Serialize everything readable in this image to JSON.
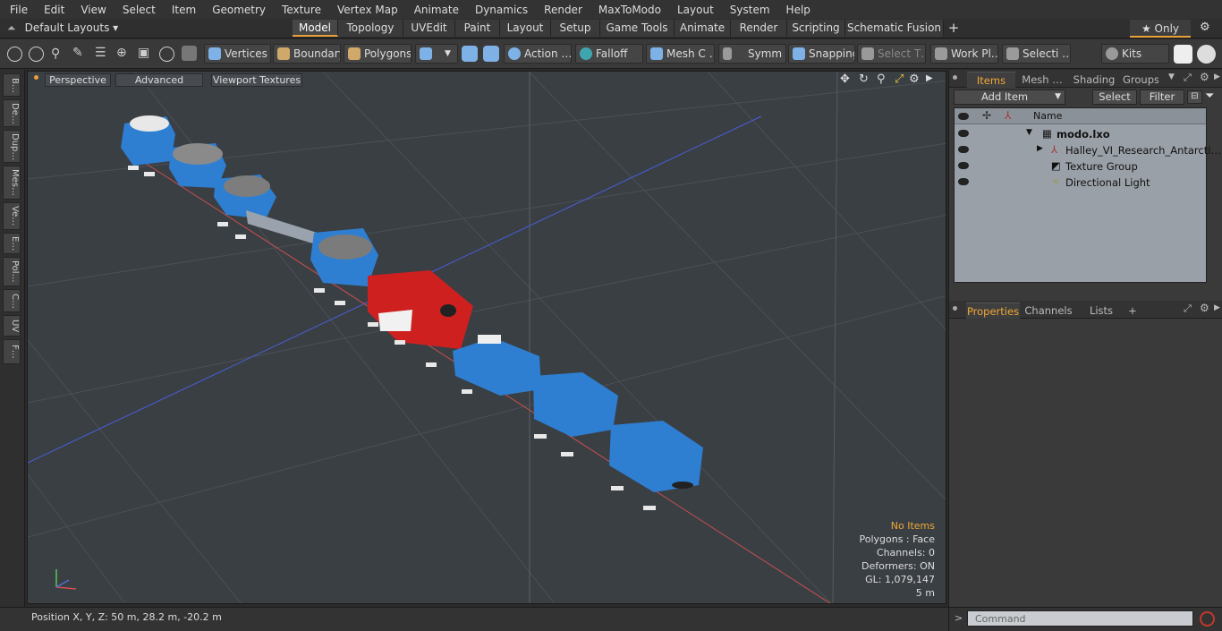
{
  "menu": [
    "File",
    "Edit",
    "View",
    "Select",
    "Item",
    "Geometry",
    "Texture",
    "Vertex Map",
    "Animate",
    "Dynamics",
    "Render",
    "MaxToModo",
    "Layout",
    "System",
    "Help"
  ],
  "layout": {
    "label": "Default Layouts ▾",
    "only_label": "★ Only"
  },
  "tabs": [
    "Model",
    "Topology",
    "UVEdit",
    "Paint",
    "Layout",
    "Setup",
    "Game Tools",
    "Animate",
    "Render",
    "Scripting",
    "Schematic Fusion"
  ],
  "tabs_add": "+",
  "toolbar": {
    "vertices": "Vertices",
    "boundary": "Boundary",
    "polygons": "Polygons",
    "action": "Action …",
    "falloff": "Falloff",
    "mesh": "Mesh C …",
    "symm": "Symm …",
    "snapping": "Snapping",
    "select_t": "Select T…",
    "workpl": "Work Pl…",
    "selecti": "Selecti …",
    "kits": "Kits"
  },
  "left_tabs": [
    "B…",
    "De…",
    "Dup…",
    "Mes…",
    "Ve…",
    "E…",
    "Pol…",
    "C…",
    "UV",
    "F…"
  ],
  "viewport": {
    "perspective": "Perspective",
    "advanced": "Advanced",
    "textures": "Viewport Textures",
    "info": {
      "items": "No Items",
      "polygons": "Polygons : Face",
      "channels": "Channels: 0",
      "deformers": "Deformers: ON",
      "gl": "GL: 1,079,147",
      "scale": "5 m"
    }
  },
  "status": {
    "position": "Position X, Y, Z:   50 m, 28.2 m, -20.2 m"
  },
  "panel": {
    "tabs": [
      "Items",
      "Mesh …",
      "Shading",
      "Groups"
    ],
    "add_item": "Add Item",
    "select": "Select",
    "filter": "Filter",
    "name_col": "Name",
    "items": [
      {
        "label": "modo.lxo"
      },
      {
        "label": "Halley_VI_Research_Antarcti…"
      },
      {
        "label": "Texture Group"
      },
      {
        "label": "Directional Light"
      }
    ],
    "prop_tabs": [
      "Properties",
      "Channels",
      "Lists",
      "+"
    ],
    "command_placeholder": "Command"
  }
}
